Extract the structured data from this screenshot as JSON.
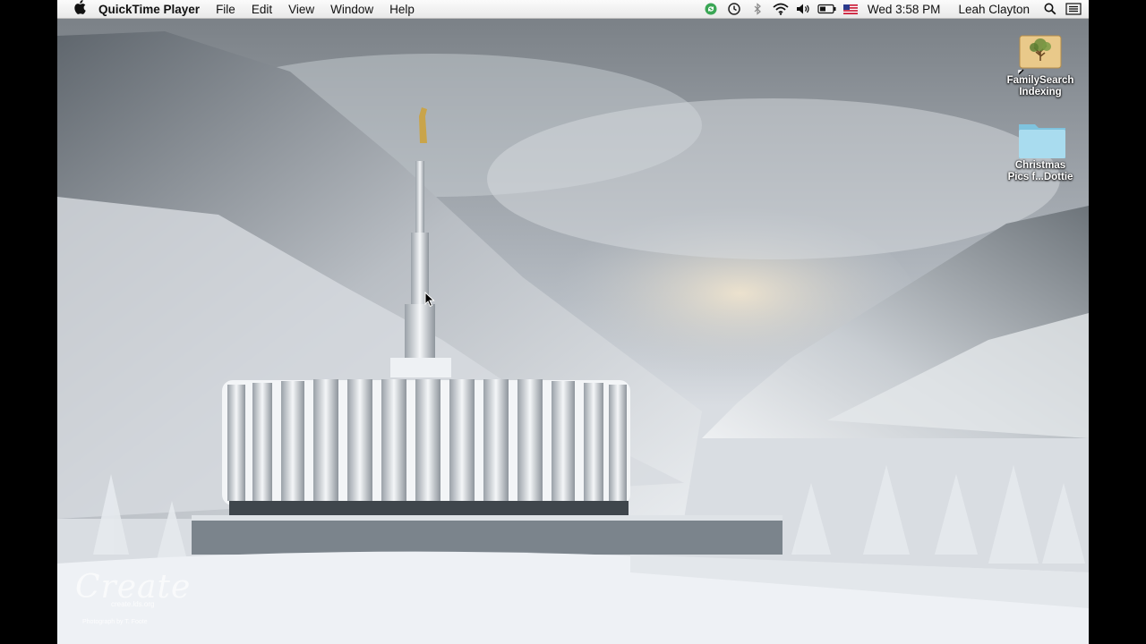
{
  "menubar": {
    "apple_icon": "apple-icon",
    "app_name": "QuickTime Player",
    "menus": [
      "File",
      "Edit",
      "View",
      "Window",
      "Help"
    ],
    "status_icons": [
      "sync-icon",
      "time-machine-icon",
      "bluetooth-icon",
      "wifi-icon",
      "volume-icon",
      "battery-icon",
      "flag-icon"
    ],
    "clock": "Wed 3:58 PM",
    "user": "Leah Clayton",
    "search_icon": "spotlight-icon",
    "list_icon": "notification-center-icon"
  },
  "desktop": {
    "icons": [
      {
        "label_line1": "FamilySearch",
        "label_line2": "Indexing",
        "type": "alias-app"
      },
      {
        "label_line1": "Christmas",
        "label_line2": "Pics f...Dottie",
        "type": "folder"
      }
    ]
  },
  "wallpaper": {
    "watermark_title": "Create",
    "watermark_url": "create.lds.org",
    "credit": "Photograph by T. Foote"
  },
  "colors": {
    "menubar_bg": "#f1f1f1",
    "sky": "#a7adb3",
    "snow": "#eef1f5",
    "folder": "#8fd0e8"
  }
}
